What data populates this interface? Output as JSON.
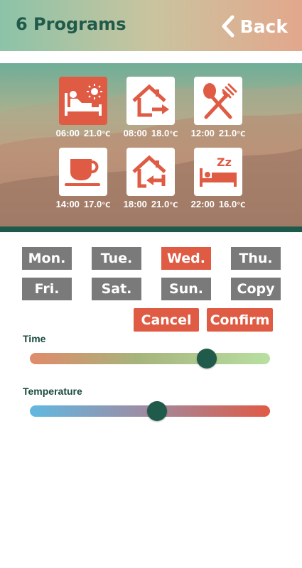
{
  "header": {
    "title": "6 Programs",
    "back_label": "Back"
  },
  "programs": [
    {
      "time": "06:00",
      "temp": "21.0",
      "unit": "℃",
      "icon": "wake-bed-icon",
      "active": true
    },
    {
      "time": "08:00",
      "temp": "18.0",
      "unit": "℃",
      "icon": "leave-home-icon",
      "active": false
    },
    {
      "time": "12:00",
      "temp": "21.0",
      "unit": "℃",
      "icon": "lunch-icon",
      "active": false
    },
    {
      "time": "14:00",
      "temp": "17.0",
      "unit": "℃",
      "icon": "coffee-cup-icon",
      "active": false
    },
    {
      "time": "18:00",
      "temp": "21.0",
      "unit": "℃",
      "icon": "return-home-icon",
      "active": false
    },
    {
      "time": "22:00",
      "temp": "16.0",
      "unit": "℃",
      "icon": "sleep-bed-icon",
      "active": false
    }
  ],
  "days": [
    {
      "label": "Mon.",
      "selected": false
    },
    {
      "label": "Tue.",
      "selected": false
    },
    {
      "label": "Wed.",
      "selected": true
    },
    {
      "label": "Thu.",
      "selected": false
    },
    {
      "label": "Fri.",
      "selected": false
    },
    {
      "label": "Sat.",
      "selected": false
    },
    {
      "label": "Sun.",
      "selected": false
    },
    {
      "label": "Copy",
      "selected": false
    }
  ],
  "actions": {
    "cancel_label": "Cancel",
    "confirm_label": "Confirm"
  },
  "sliders": {
    "time": {
      "label": "Time",
      "value": 0.74
    },
    "temperature": {
      "label": "Temperature",
      "value": 0.53
    }
  },
  "colors": {
    "accent": "#df5b43",
    "dark_green": "#1f5a4a",
    "day_button": "#7a7a7a",
    "time_track_start": "#e08a6a",
    "time_track_end": "#b8e0a0",
    "temp_track_start": "#62b8e0",
    "temp_track_end": "#e05a45"
  }
}
